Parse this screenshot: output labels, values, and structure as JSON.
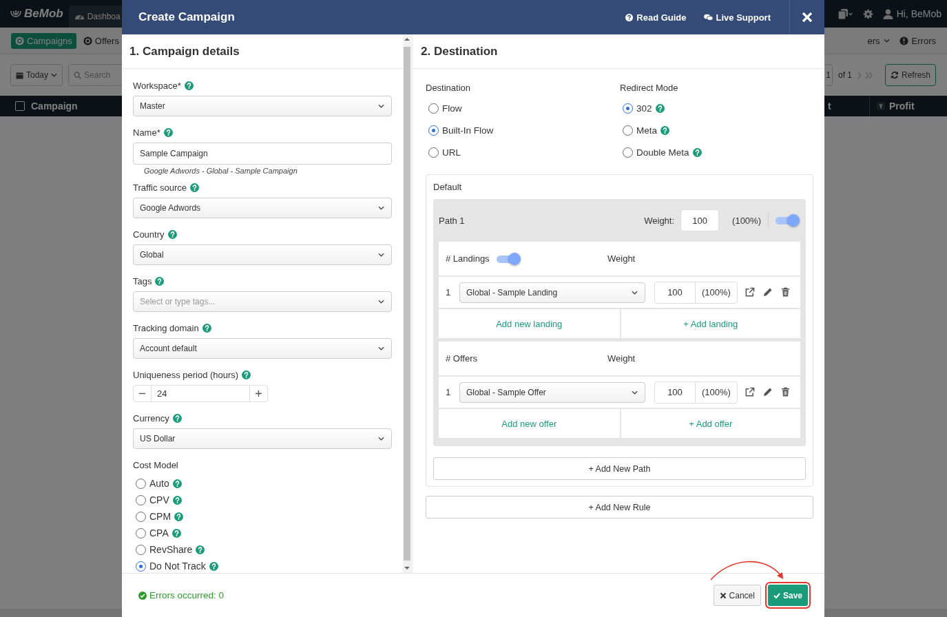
{
  "background": {
    "logo": "BeMob",
    "nav_tab": "Dashboa",
    "user": "Hi, BeMob",
    "sections": [
      {
        "label": "Campaigns",
        "selected": true
      },
      {
        "label": "Offers",
        "selected": false
      }
    ],
    "right_links": [
      {
        "label": "ers",
        "kind": "dropdown"
      },
      {
        "label": "Errors",
        "kind": "alert"
      }
    ],
    "date_filter": "Today",
    "search": {
      "placeholder": "Search"
    },
    "pager": {
      "page": "1",
      "total": "of 1"
    },
    "refresh": "Refresh",
    "table_columns": [
      {
        "label": "Campaign",
        "kind": "check",
        "checked": false
      },
      {
        "label": "t",
        "kind": "plain"
      },
      {
        "label": "Profit",
        "kind": "filter"
      }
    ]
  },
  "modal": {
    "title": "Create Campaign",
    "links": [
      {
        "label": "Read Guide",
        "kind": "guide"
      },
      {
        "label": "Live Support",
        "kind": "chat"
      }
    ],
    "details": {
      "heading": "1. Campaign details",
      "fields": [
        {
          "kind": "select",
          "label": "Workspace*",
          "help": true,
          "value": "Master"
        },
        {
          "kind": "text",
          "label": "Name*",
          "help": true,
          "value": "Sample Campaign",
          "hint": "Google Adwords - Global - Sample Campaign"
        },
        {
          "kind": "select",
          "label": "Traffic source",
          "help": true,
          "value": "Google Adwords"
        },
        {
          "kind": "select",
          "label": "Country",
          "help": true,
          "value": "Global"
        },
        {
          "kind": "select",
          "label": "Tags",
          "help": true,
          "placeholder": "Select or type tags..."
        },
        {
          "kind": "select",
          "label": "Tracking domain",
          "help": true,
          "value": "Account default"
        },
        {
          "kind": "stepper",
          "label": "Uniqueness period (hours)",
          "help": true,
          "value": "24"
        },
        {
          "kind": "select",
          "label": "Currency",
          "help": true,
          "value": "US Dollar"
        }
      ],
      "cost_model": {
        "label": "Cost Model",
        "options": [
          {
            "label": "Auto",
            "selected": false,
            "help": true
          },
          {
            "label": "CPV",
            "selected": false,
            "help": true
          },
          {
            "label": "CPM",
            "selected": false,
            "help": true
          },
          {
            "label": "CPA",
            "selected": false,
            "help": true
          },
          {
            "label": "RevShare",
            "selected": false,
            "help": true
          },
          {
            "label": "Do Not Track",
            "selected": true,
            "help": true
          }
        ]
      }
    },
    "destination": {
      "heading": "2. Destination",
      "destination_group": {
        "label": "Destination",
        "options": [
          {
            "label": "Flow",
            "selected": false
          },
          {
            "label": "Built-In Flow",
            "selected": true
          },
          {
            "label": "URL",
            "selected": false
          }
        ]
      },
      "redirect_group": {
        "label": "Redirect Mode",
        "options": [
          {
            "label": "302",
            "selected": true,
            "help": true
          },
          {
            "label": "Meta",
            "selected": false,
            "help": true
          },
          {
            "label": "Double Meta",
            "selected": false,
            "help": true
          }
        ]
      },
      "rule": {
        "title": "Default",
        "path": {
          "name": "Path 1",
          "weight_label": "Weight:",
          "weight": "100",
          "share": "(100%)",
          "on": true,
          "sections": [
            {
              "title": "# Landings",
              "on": true,
              "weight_label": "Weight",
              "items": [
                {
                  "index": "1",
                  "value": "Global - Sample Landing",
                  "weight": "100",
                  "share": "(100%)"
                }
              ],
              "add_new": "Add new landing",
              "add_existing": "+ Add landing"
            },
            {
              "title": "# Offers",
              "weight_label": "Weight",
              "items": [
                {
                  "index": "1",
                  "value": "Global - Sample Offer",
                  "weight": "100",
                  "share": "(100%)"
                }
              ],
              "add_new": "Add new offer",
              "add_existing": "+ Add offer"
            }
          ]
        },
        "add_path": "+ Add New Path"
      },
      "add_rule": "+ Add New Rule"
    },
    "footer": {
      "status": "Errors occurred: 0",
      "cancel": "Cancel",
      "save": {
        "label": "Save",
        "highlighted": true
      }
    }
  }
}
